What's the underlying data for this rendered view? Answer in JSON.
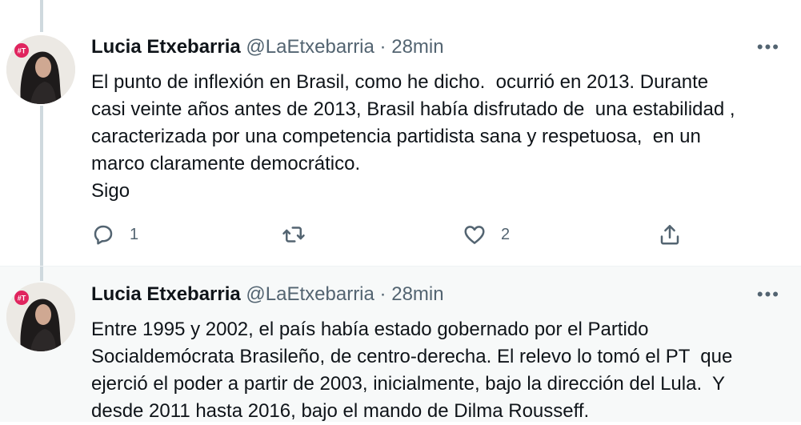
{
  "tweets": [
    {
      "author_name": "Lucia Etxebarria",
      "handle": "@LaEtxebarria",
      "separator": "·",
      "time": "28min",
      "more_label": "•••",
      "avatar_badge": "#T",
      "body_lines": [
        "El punto de inflexión en Brasil, como he dicho.  ocurrió en 2013. Durante",
        "casi veinte años antes de 2013, Brasil había disfrutado de  una estabilidad ,",
        "caracterizada por una competencia partidista sana y respetuosa,  en un",
        "marco claramente democrático.",
        "Sigo"
      ],
      "reply_count": "1",
      "retweet_count": "",
      "like_count": "2"
    },
    {
      "author_name": "Lucia Etxebarria",
      "handle": "@LaEtxebarria",
      "separator": "·",
      "time": "28min",
      "more_label": "•••",
      "avatar_badge": "#T",
      "body_lines": [
        "Entre 1995 y 2002, el país había estado gobernado por el Partido",
        "Socialdemócrata Brasileño, de centro-derecha. El relevo lo tomó el PT  que",
        "ejerció el poder a partir de 2003, inicialmente, bajo la dirección del Lula.  Y",
        "desde 2011 hasta 2016, bajo el mando de Dilma Rousseff."
      ]
    }
  ],
  "icons": {
    "reply": "reply-icon",
    "retweet": "retweet-icon",
    "like": "heart-icon",
    "share": "share-icon",
    "more": "more-icon"
  },
  "colors": {
    "secondary_text": "#536471",
    "thread_line": "#cfd9de",
    "badge": "#e0245e"
  }
}
